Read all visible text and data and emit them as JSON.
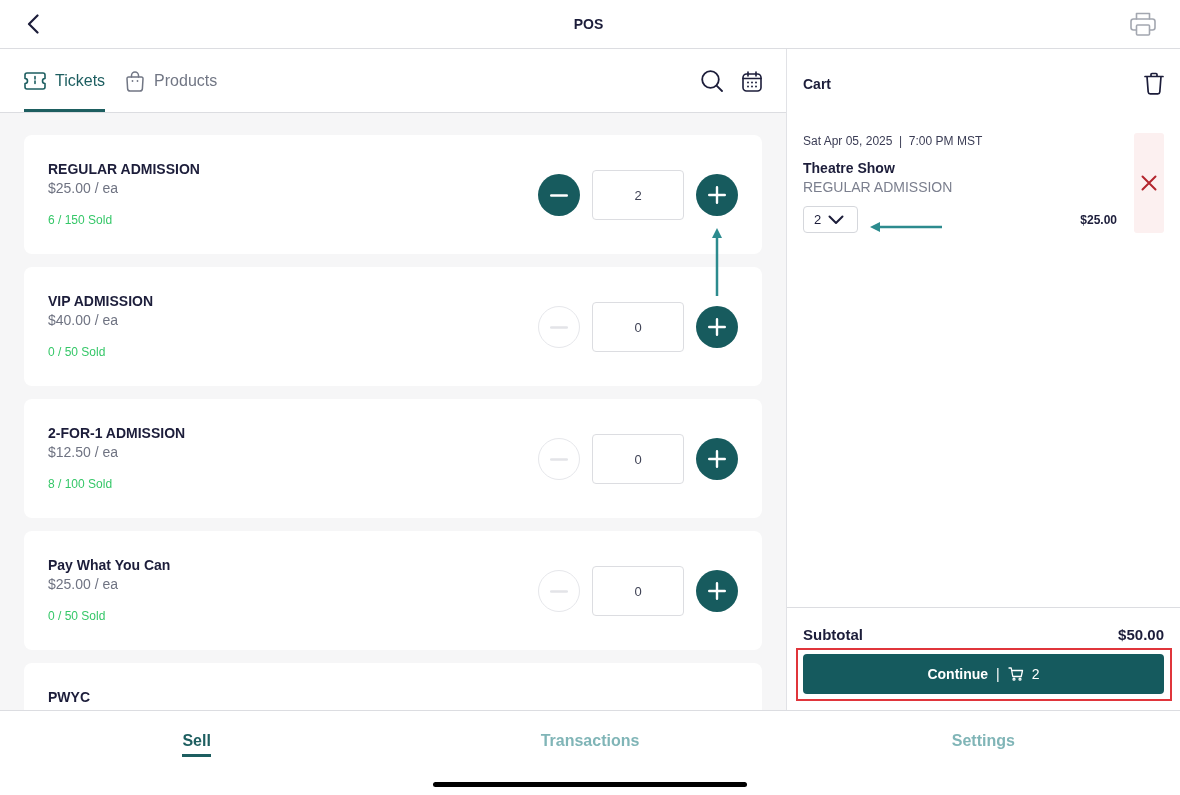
{
  "header": {
    "title": "POS"
  },
  "tabs": [
    {
      "label": "Tickets",
      "selected": true
    },
    {
      "label": "Products",
      "selected": false
    }
  ],
  "tickets": [
    {
      "name": "REGULAR ADMISSION",
      "price": "$25.00 / ea",
      "sold": "6 / 150 Sold",
      "quantity": "2",
      "decrement_disabled": false,
      "callout_arrow": true
    },
    {
      "name": "VIP ADMISSION",
      "price": "$40.00 / ea",
      "sold": "0 / 50 Sold",
      "quantity": "0",
      "decrement_disabled": true,
      "callout_arrow": false
    },
    {
      "name": "2-FOR-1 ADMISSION",
      "price": "$12.50 / ea",
      "sold": "8 / 100 Sold",
      "quantity": "0",
      "decrement_disabled": true,
      "callout_arrow": false
    },
    {
      "name": "Pay What You Can",
      "price": "$25.00 / ea",
      "sold": "0 / 50 Sold",
      "quantity": "0",
      "decrement_disabled": true,
      "callout_arrow": false
    },
    {
      "name": "PWYC"
    }
  ],
  "cart": {
    "title": "Cart",
    "items": [
      {
        "datetime": "Sat Apr 05, 2025  |  7:00 PM MST",
        "event": "Theatre Show",
        "ticket_type": "REGULAR ADMISSION",
        "quantity": "2",
        "price": "$25.00",
        "callout_arrow": true
      }
    ],
    "subtotal": {
      "label": "Subtotal",
      "value": "$50.00"
    },
    "continue_button": {
      "label": "Continue",
      "separator": "|",
      "count": "2",
      "highlighted": true
    }
  },
  "bottom_nav": [
    {
      "label": "Sell",
      "selected": true
    },
    {
      "label": "Transactions",
      "selected": false
    },
    {
      "label": "Settings",
      "selected": false
    }
  ]
}
